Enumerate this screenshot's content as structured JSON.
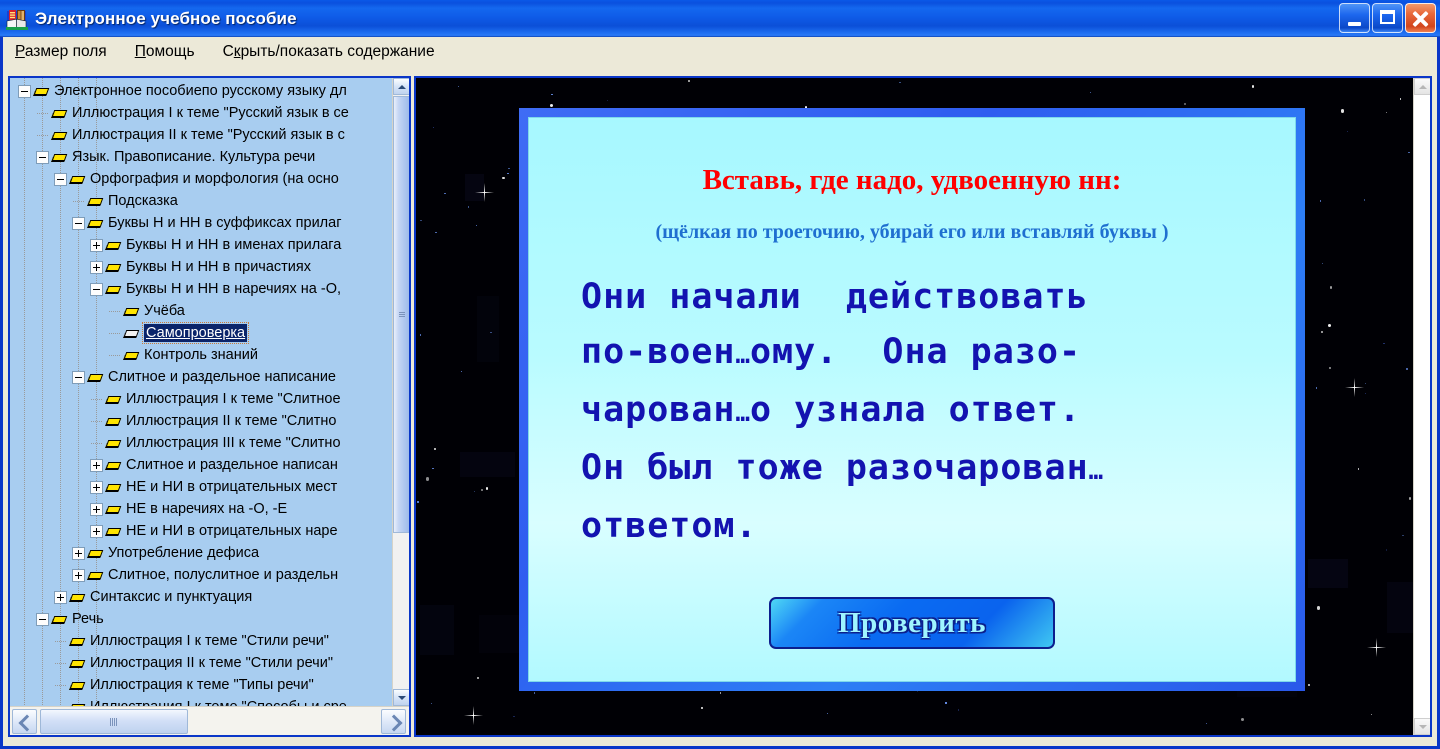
{
  "window": {
    "title": "Электронное учебное пособие",
    "icon": "book-icon",
    "minimize_label": "Свернуть",
    "maximize_label": "Развернуть",
    "close_label": "Закрыть"
  },
  "menu": {
    "items": [
      {
        "label": "Размер поля",
        "accel": "Р"
      },
      {
        "label": "Помощь",
        "accel": "П"
      },
      {
        "label": "Скрыть/показать содержание",
        "accel": "к"
      }
    ]
  },
  "tree": {
    "items": [
      {
        "label": "Электронное пособиепо русскому языку дл",
        "depth": 0,
        "state": "minus",
        "icon": "book-icon",
        "selected": false
      },
      {
        "label": "Иллюстрация I к теме \"Русский язык в се",
        "depth": 1,
        "state": "leaf",
        "icon": "book-icon",
        "selected": false
      },
      {
        "label": "Иллюстрация II к теме \"Русский язык в с",
        "depth": 1,
        "state": "leaf",
        "icon": "book-icon",
        "selected": false
      },
      {
        "label": "Язык. Правописание. Культура речи",
        "depth": 1,
        "state": "minus",
        "icon": "book-icon",
        "selected": false
      },
      {
        "label": "Орфография и морфология (на осно",
        "depth": 2,
        "state": "minus",
        "icon": "book-icon",
        "selected": false
      },
      {
        "label": "Подсказка",
        "depth": 3,
        "state": "leaf",
        "icon": "book-icon",
        "selected": false
      },
      {
        "label": "Буквы Н и НН в суффиксах прилаг",
        "depth": 3,
        "state": "minus",
        "icon": "book-icon",
        "selected": false
      },
      {
        "label": "Буквы Н и НН в именах прилага",
        "depth": 4,
        "state": "plus",
        "icon": "book-icon",
        "selected": false
      },
      {
        "label": "Буквы Н и НН в причастиях",
        "depth": 4,
        "state": "plus",
        "icon": "book-icon",
        "selected": false
      },
      {
        "label": "Буквы Н и НН в наречиях на -О,",
        "depth": 4,
        "state": "minus",
        "icon": "book-icon",
        "selected": false
      },
      {
        "label": "Учёба",
        "depth": 5,
        "state": "leaf",
        "icon": "book-icon",
        "selected": false
      },
      {
        "label": "Самопроверка",
        "depth": 5,
        "state": "leaf",
        "icon": "book-open-icon",
        "selected": true
      },
      {
        "label": "Контроль знаний",
        "depth": 5,
        "state": "leaf",
        "icon": "book-icon",
        "selected": false
      },
      {
        "label": "Слитное и раздельное написание",
        "depth": 3,
        "state": "minus",
        "icon": "book-icon",
        "selected": false
      },
      {
        "label": "Иллюстрация I к теме \"Слитное",
        "depth": 4,
        "state": "leaf",
        "icon": "book-icon",
        "selected": false
      },
      {
        "label": "Иллюстрация II к теме \"Слитно",
        "depth": 4,
        "state": "leaf",
        "icon": "book-icon",
        "selected": false
      },
      {
        "label": "Иллюстрация III к теме \"Слитно",
        "depth": 4,
        "state": "leaf",
        "icon": "book-icon",
        "selected": false
      },
      {
        "label": "Слитное и раздельное написан",
        "depth": 4,
        "state": "plus",
        "icon": "book-icon",
        "selected": false
      },
      {
        "label": "НЕ и НИ в отрицательных мест",
        "depth": 4,
        "state": "plus",
        "icon": "book-icon",
        "selected": false
      },
      {
        "label": "НЕ в наречиях на -О, -Е",
        "depth": 4,
        "state": "plus",
        "icon": "book-icon",
        "selected": false
      },
      {
        "label": "НЕ и НИ в отрицательных наре",
        "depth": 4,
        "state": "plus",
        "icon": "book-icon",
        "selected": false
      },
      {
        "label": "Употребление дефиса",
        "depth": 3,
        "state": "plus",
        "icon": "book-icon",
        "selected": false
      },
      {
        "label": "Слитное, полуслитное и раздельн",
        "depth": 3,
        "state": "plus",
        "icon": "book-icon",
        "selected": false
      },
      {
        "label": "Синтаксис и пунктуация",
        "depth": 2,
        "state": "plus",
        "icon": "book-icon",
        "selected": false
      },
      {
        "label": "Речь",
        "depth": 1,
        "state": "minus",
        "icon": "book-icon",
        "selected": false
      },
      {
        "label": "Иллюстрация I к теме \"Стили речи\"",
        "depth": 2,
        "state": "leaf",
        "icon": "book-icon",
        "selected": false
      },
      {
        "label": "Иллюстрация II к теме \"Стили речи\"",
        "depth": 2,
        "state": "leaf",
        "icon": "book-icon",
        "selected": false
      },
      {
        "label": "Иллюстрация к теме \"Типы речи\"",
        "depth": 2,
        "state": "leaf",
        "icon": "book-icon",
        "selected": false
      },
      {
        "label": "Иллюстрация I к теме \"Способы и сре",
        "depth": 2,
        "state": "leaf",
        "icon": "book-icon",
        "selected": false
      }
    ]
  },
  "slide": {
    "title": "Вставь, где надо, удвоенную нн:",
    "subtitle": "(щёлкая по троеточию, убирай его или вставляй буквы )",
    "body_lines": [
      "Они начали  действовать",
      "по-воен…ому.  Она разо-",
      "чарован…о узнала ответ.",
      "Он был тоже разочарован…",
      "ответом."
    ],
    "check_button_label": "Проверить",
    "colors": {
      "title": "#ff0000",
      "subtitle": "#1f6fd0",
      "body": "#1313b0",
      "card_bg": "#b9fbff",
      "card_border": "#2f5df0",
      "button_text": "#9ff4ff"
    }
  },
  "scrollbars": {
    "tree_vertical": {
      "up": "▲",
      "down": "▼",
      "enabled": true
    },
    "tree_horizontal": {
      "left": "◀",
      "right": "▶",
      "enabled": true
    },
    "content_vertical": {
      "up": "▲",
      "down": "▼",
      "enabled": false
    }
  }
}
